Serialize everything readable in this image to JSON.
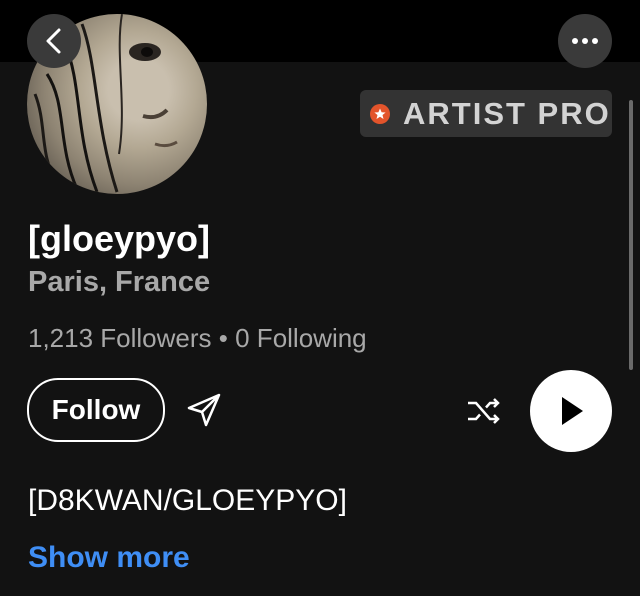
{
  "header": {
    "back_icon": "chevron-left-icon",
    "more_icon": "ellipsis-icon"
  },
  "profile": {
    "avatar_alt": "",
    "badge": {
      "label": "ARTIST PRO",
      "icon": "star-badge-icon",
      "color": "#e3542b"
    },
    "name": "[gloeypyo]",
    "location": "Paris, France",
    "followers_text": "1,213 Followers",
    "separator": "•",
    "following_text": "0 Following"
  },
  "actions": {
    "follow_label": "Follow",
    "share_icon": "send-icon",
    "shuffle_icon": "shuffle-icon",
    "play_icon": "play-icon"
  },
  "bio": {
    "text": "[D8KWAN/GLOEYPYO]",
    "show_more_label": "Show more",
    "link_color": "#3f8ef5"
  }
}
